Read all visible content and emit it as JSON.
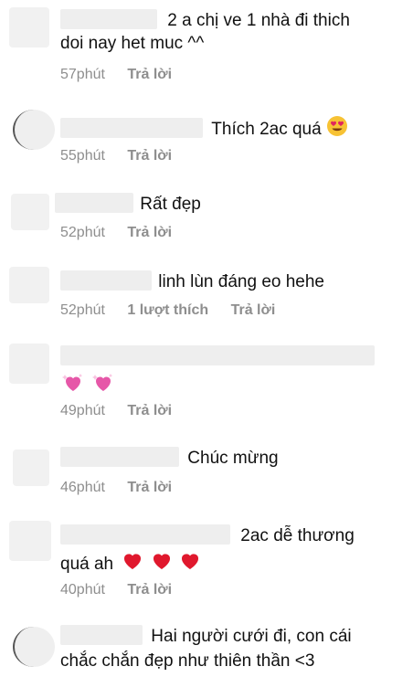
{
  "comments": [
    {
      "line1": "2 a chị ve 1 nhà đi thich",
      "line2": "doi nay het muc ^^",
      "time": "57phút",
      "reply": "Trả lời"
    },
    {
      "line1": "Thích 2ac quá",
      "time": "55phút",
      "reply": "Trả lời",
      "emoji": "heart-eyes"
    },
    {
      "line1": "Rất đẹp",
      "time": "52phút",
      "reply": "Trả lời"
    },
    {
      "line1": "linh lùn đáng eo hehe",
      "time": "52phút",
      "likes": "1 lượt thích",
      "reply": "Trả lời"
    },
    {
      "time": "49phút",
      "reply": "Trả lời",
      "emoji": "sparkling-heart x2"
    },
    {
      "line1": "Chúc mừng",
      "time": "46phút",
      "reply": "Trả lời"
    },
    {
      "line1": "2ac dễ thương",
      "line2": "quá ah",
      "time": "40phút",
      "reply": "Trả lời",
      "emoji": "red-heart x3"
    },
    {
      "line1": "Hai người cưới đi, con cái",
      "line2": "chắc chắn đẹp như thiên thần <3"
    }
  ]
}
